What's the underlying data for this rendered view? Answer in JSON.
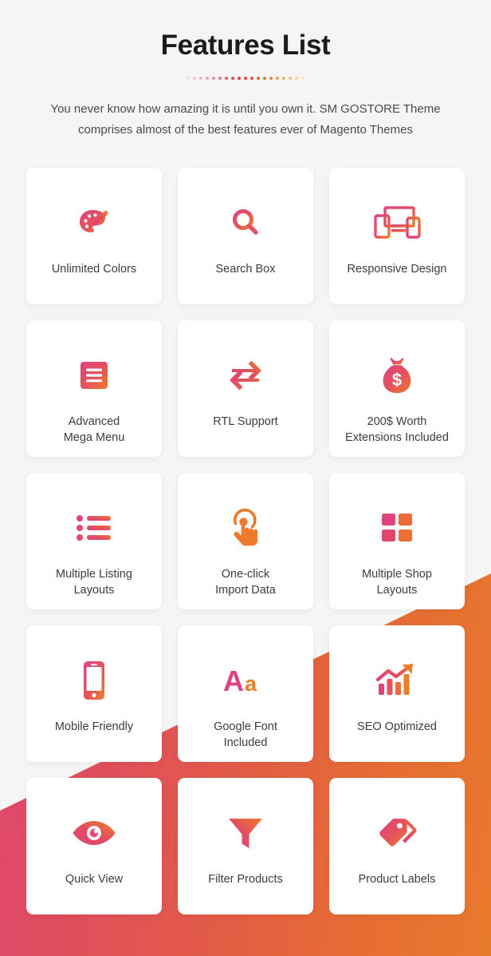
{
  "header": {
    "title": "Features List",
    "subtitle": "You never know how amazing it is until you own it. SM GOSTORE Theme comprises almost of the best features ever of Magento Themes",
    "dot_count": 19
  },
  "theme": {
    "page_background": "#f5f5f5",
    "card_background": "#ffffff",
    "title_color": "#1b1b1b",
    "subtitle_color": "#4a4a4a",
    "label_color": "#3c3c3c",
    "accent_pink": "#e0457a",
    "accent_crimson": "#e2496a",
    "accent_orange": "#e8762e",
    "wedge_gradient_from": "#d8417e",
    "wedge_gradient_to": "#e87a2c"
  },
  "features": [
    {
      "icon": "palette-icon",
      "label_line1": "Unlimited Colors",
      "label_line2": ""
    },
    {
      "icon": "search-icon",
      "label_line1": "Search Box",
      "label_line2": ""
    },
    {
      "icon": "responsive-devices-icon",
      "label_line1": "Responsive Design",
      "label_line2": ""
    },
    {
      "icon": "hamburger-menu-icon",
      "label_line1": "Advanced",
      "label_line2": "Mega Menu"
    },
    {
      "icon": "exchange-arrows-icon",
      "label_line1": "RTL Support",
      "label_line2": ""
    },
    {
      "icon": "money-bag-icon",
      "label_line1": "200$ Worth",
      "label_line2": "Extensions Included"
    },
    {
      "icon": "bulleted-list-icon",
      "label_line1": "Multiple Listing",
      "label_line2": "Layouts"
    },
    {
      "icon": "hand-tap-icon",
      "label_line1": "One-click",
      "label_line2": "Import Data"
    },
    {
      "icon": "grid-squares-icon",
      "label_line1": "Multiple Shop",
      "label_line2": "Layouts"
    },
    {
      "icon": "mobile-phone-icon",
      "label_line1": "Mobile Friendly",
      "label_line2": ""
    },
    {
      "icon": "font-aa-icon",
      "label_line1": "Google Font",
      "label_line2": "Included"
    },
    {
      "icon": "growth-chart-icon",
      "label_line1": "SEO Optimized",
      "label_line2": ""
    },
    {
      "icon": "eye-icon",
      "label_line1": "Quick View",
      "label_line2": ""
    },
    {
      "icon": "funnel-icon",
      "label_line1": "Filter Products",
      "label_line2": ""
    },
    {
      "icon": "price-tags-icon",
      "label_line1": "Product Labels",
      "label_line2": ""
    }
  ]
}
